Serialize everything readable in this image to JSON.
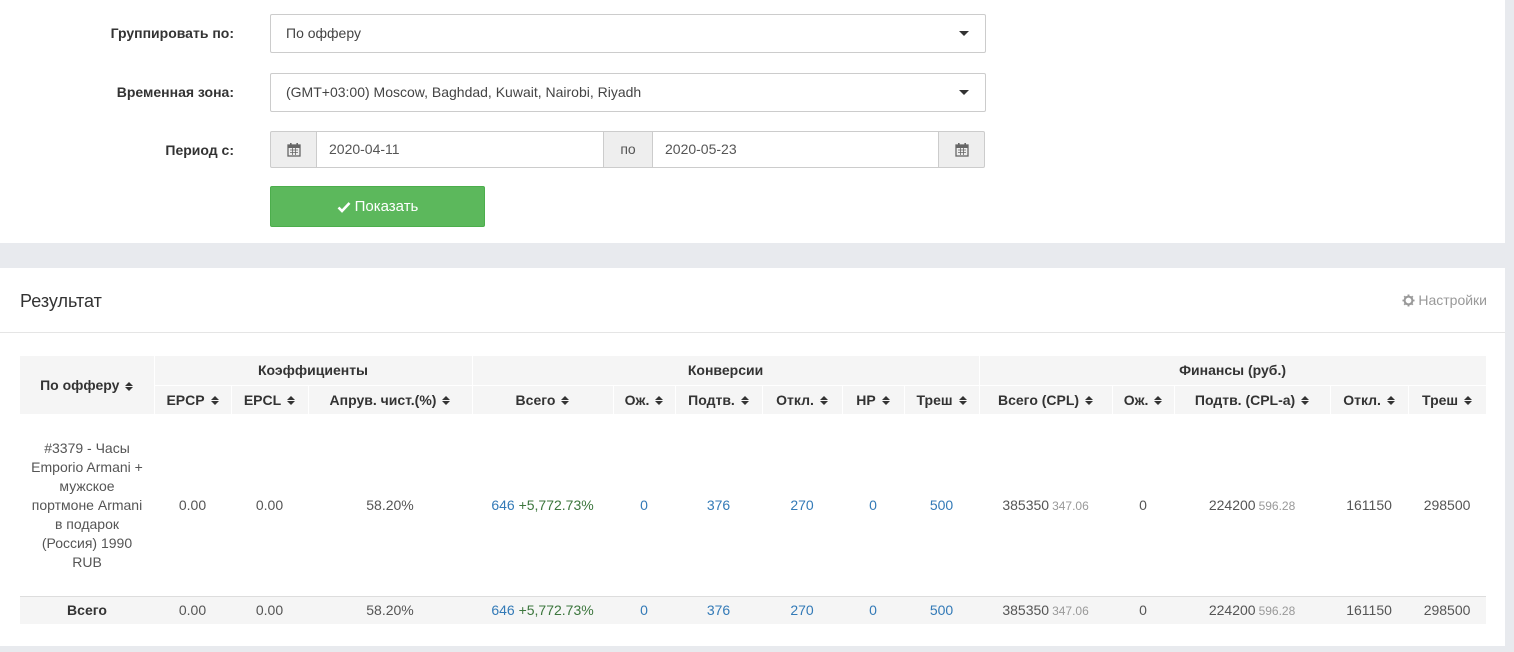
{
  "filters": {
    "group_label": "Группировать по:",
    "group_value": "По офферу",
    "timezone_label": "Временная зона:",
    "timezone_value": "(GMT+03:00) Moscow, Baghdad, Kuwait, Nairobi, Riyadh",
    "period_label": "Период с:",
    "date_from": "2020-04-11",
    "to_label": "по",
    "date_to": "2020-05-23",
    "show_button": "Показать"
  },
  "results": {
    "title": "Результат",
    "settings_label": "Настройки",
    "group_headers": {
      "offer": "По офферу",
      "coef": "Коэффициенты",
      "conv": "Конверсии",
      "fin": "Финансы (руб.)"
    },
    "columns": {
      "epcp": "EPCP",
      "epcl": "EPCL",
      "approve": "Апрув. чист.(%)",
      "conv_total": "Всего",
      "conv_wait": "Ож.",
      "conv_confirm": "Подтв.",
      "conv_reject": "Откл.",
      "conv_np": "НР",
      "conv_trash": "Треш",
      "fin_total": "Всего (CPL)",
      "fin_wait": "Ож.",
      "fin_confirm": "Подтв. (CPL-a)",
      "fin_reject": "Откл.",
      "fin_trash": "Треш"
    },
    "row": {
      "offer": "#3379 - Часы Emporio Armani + мужское портмоне Armani в подарок (Россия) 1990 RUB",
      "epcp": "0.00",
      "epcl": "0.00",
      "approve": "58.20%",
      "conv_total": "646",
      "conv_total_delta": "+5,772.73%",
      "conv_wait": "0",
      "conv_confirm": "376",
      "conv_reject": "270",
      "conv_np": "0",
      "conv_trash": "500",
      "fin_total": "385350",
      "fin_total_cpl": "347.06",
      "fin_wait": "0",
      "fin_confirm": "224200",
      "fin_confirm_cpl": "596.28",
      "fin_reject": "161150",
      "fin_trash": "298500"
    },
    "total": {
      "label": "Всего",
      "epcp": "0.00",
      "epcl": "0.00",
      "approve": "58.20%",
      "conv_total": "646",
      "conv_total_delta": "+5,772.73%",
      "conv_wait": "0",
      "conv_confirm": "376",
      "conv_reject": "270",
      "conv_np": "0",
      "conv_trash": "500",
      "fin_total": "385350",
      "fin_total_cpl": "347.06",
      "fin_wait": "0",
      "fin_confirm": "224200",
      "fin_confirm_cpl": "596.28",
      "fin_reject": "161150",
      "fin_trash": "298500"
    }
  },
  "icons": {
    "dropdown": "caret-down-icon",
    "calendar": "calendar-icon",
    "check": "check-icon",
    "settings": "gear-icon",
    "sort": "sort-icon"
  },
  "colors": {
    "success": "#5cb85c",
    "link": "#337ab7",
    "positive": "#3c763d",
    "header_bg": "#f5f5f5"
  }
}
